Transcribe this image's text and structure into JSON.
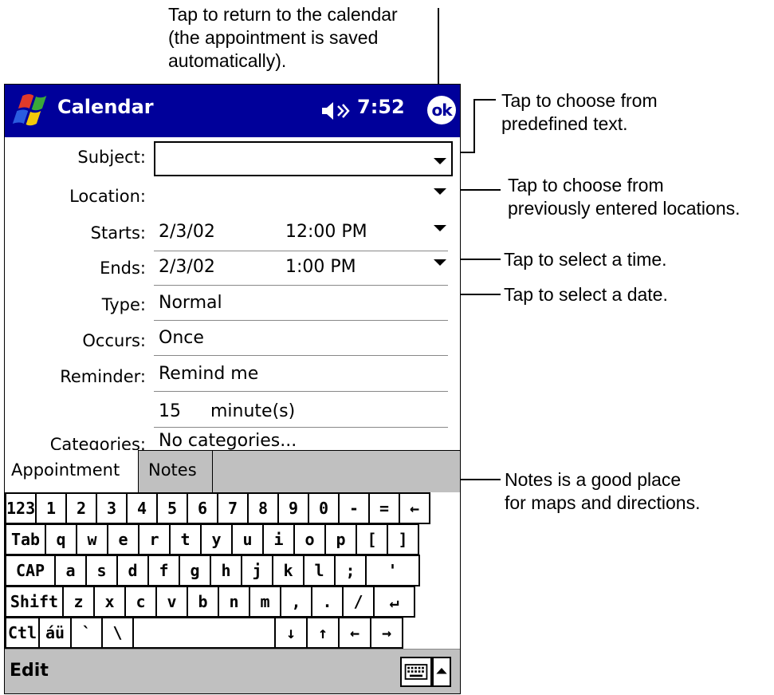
{
  "callouts": {
    "return_line1": "Tap to return to the calendar",
    "return_line2": "(the appointment is saved",
    "return_line3": "automatically).",
    "predefined_line1": "Tap to choose from",
    "predefined_line2": "predefined text.",
    "locations_line1": "Tap to choose from",
    "locations_line2": "previously entered locations.",
    "time": "Tap to select a time.",
    "date": "Tap to select a date.",
    "notes_line1": "Notes is a good place",
    "notes_line2": "for maps and directions."
  },
  "titlebar": {
    "title": "Calendar",
    "time": "7:52",
    "ok_label": "ok",
    "color": "#00009a"
  },
  "form": {
    "subject_label": "Subject:",
    "subject_value": "",
    "location_label": "Location:",
    "location_value": "",
    "starts_label": "Starts:",
    "starts_date": "2/3/02",
    "starts_time": "12:00 PM",
    "ends_label": "Ends:",
    "ends_date": "2/3/02",
    "ends_time": "1:00 PM",
    "type_label": "Type:",
    "type_value": "Normal",
    "occurs_label": "Occurs:",
    "occurs_value": "Once",
    "reminder_label": "Reminder:",
    "reminder_value": "Remind me",
    "reminder_amount": "15",
    "reminder_unit": "minute(s)",
    "categories_label": "Categories:",
    "categories_value": "No categories..."
  },
  "tabs": [
    "Appointment",
    "Notes"
  ],
  "keyboard": {
    "row1": [
      "123",
      "1",
      "2",
      "3",
      "4",
      "5",
      "6",
      "7",
      "8",
      "9",
      "0",
      "-",
      "=",
      "←"
    ],
    "row2": [
      "Tab",
      "q",
      "w",
      "e",
      "r",
      "t",
      "y",
      "u",
      "i",
      "o",
      "p",
      "[",
      "]"
    ],
    "row3": [
      "CAP",
      "a",
      "s",
      "d",
      "f",
      "g",
      "h",
      "j",
      "k",
      "l",
      ";",
      "'"
    ],
    "row4": [
      "Shift",
      "z",
      "x",
      "c",
      "v",
      "b",
      "n",
      "m",
      ",",
      ".",
      "/",
      "↵"
    ],
    "row5": [
      "Ctl",
      "áü",
      "`",
      "\\",
      "",
      "↓",
      "↑",
      "←",
      "→"
    ]
  },
  "menubar": {
    "edit_label": "Edit",
    "icons": [
      "keyboard-icon",
      "up-arrow-icon"
    ]
  }
}
